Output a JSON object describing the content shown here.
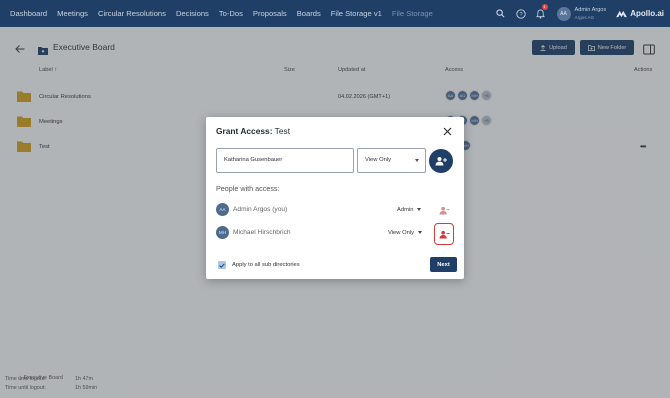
{
  "nav": {
    "items": [
      "Dashboard",
      "Meetings",
      "Circular Resolutions",
      "Decisions",
      "To-Dos",
      "Proposals",
      "Boards",
      "File Storage v1",
      "File Storage"
    ],
    "notification_count": "1",
    "user_initials": "AA",
    "user_name": "Admin Argos",
    "user_org": "Argos AG",
    "brand": "Apollo.ai"
  },
  "page": {
    "title": "Executive Board",
    "upload_label": "Upload",
    "new_folder_label": "New Folder"
  },
  "table": {
    "headers": {
      "label": "Label",
      "size": "Size",
      "updated": "Updated at",
      "access": "Access",
      "actions": "Actions"
    },
    "rows": [
      {
        "name": "Circular Resolutions",
        "updated": "04.02.2026 (GMT+1)",
        "avatars": [
          "AA",
          "AG",
          "MH"
        ],
        "more": "+5",
        "actions": ""
      },
      {
        "name": "Meetings",
        "updated": "",
        "avatars": [
          "AA",
          "AG",
          "MH"
        ],
        "more": "+5",
        "actions": ""
      },
      {
        "name": "Test",
        "updated": "",
        "avatars": [
          "MH"
        ],
        "more": "",
        "actions": "•••"
      }
    ]
  },
  "footer": {
    "label1": "Time until logout:",
    "val1": "1h 47m",
    "label2": "Time until logout:",
    "val2": "1h 59min",
    "overlay_text": "Executive Board"
  },
  "modal": {
    "title_prefix": "Grant Access:",
    "title_name": "Test",
    "input_value": "Katharina Gusenbauer",
    "role_value": "View Only",
    "people_label": "People with access:",
    "people": [
      {
        "initials": "AA",
        "name": "Admin Argos (you)",
        "role": "Admin"
      },
      {
        "initials": "MH",
        "name": "Michael Hirschbrich",
        "role": "View Only"
      }
    ],
    "checkbox_label": "Apply to all sub directories",
    "checkbox_checked": true,
    "next_label": "Next"
  },
  "colors": {
    "primary": "#1f3f66",
    "folder": "#c79a1e",
    "remove_icon": "#d63a3a",
    "focus_ring": "#d63a3a"
  }
}
